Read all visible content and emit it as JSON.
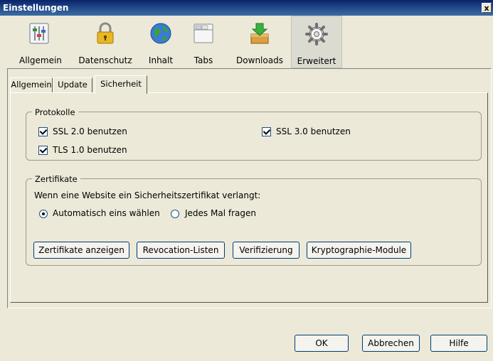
{
  "window": {
    "title": "Einstellungen",
    "close_glyph": "x"
  },
  "toolbar": {
    "items": [
      {
        "label": "Allgemein",
        "icon": "sliders-icon",
        "selected": false
      },
      {
        "label": "Datenschutz",
        "icon": "padlock-icon",
        "selected": false
      },
      {
        "label": "Inhalt",
        "icon": "globe-icon",
        "selected": false
      },
      {
        "label": "Tabs",
        "icon": "tabs-window-icon",
        "selected": false
      },
      {
        "label": "Downloads",
        "icon": "download-box-icon",
        "selected": false
      },
      {
        "label": "Erweitert",
        "icon": "gear-icon",
        "selected": true
      }
    ]
  },
  "subtabs": [
    {
      "label": "Allgemein",
      "active": false
    },
    {
      "label": "Update",
      "active": false
    },
    {
      "label": "Sicherheit",
      "active": true
    }
  ],
  "protokolle": {
    "legend": "Protokolle",
    "ssl2": {
      "label": "SSL 2.0 benutzen",
      "checked": true
    },
    "ssl3": {
      "label": "SSL 3.0 benutzen",
      "checked": true
    },
    "tls1": {
      "label": "TLS 1.0 benutzen",
      "checked": true
    }
  },
  "zertifikate": {
    "legend": "Zertifikate",
    "description": "Wenn eine Website ein Sicherheitszertifikat verlangt:",
    "radio_auto": {
      "label": "Automatisch eins wählen",
      "selected": true
    },
    "radio_ask": {
      "label": "Jedes Mal fragen",
      "selected": false
    },
    "buttons": {
      "show": "Zertifikate anzeigen",
      "revocation": "Revocation-Listen",
      "verify": "Verifizierung",
      "crypto": "Kryptographie-Module"
    }
  },
  "footer": {
    "ok": "OK",
    "cancel": "Abbrechen",
    "help": "Hilfe"
  }
}
